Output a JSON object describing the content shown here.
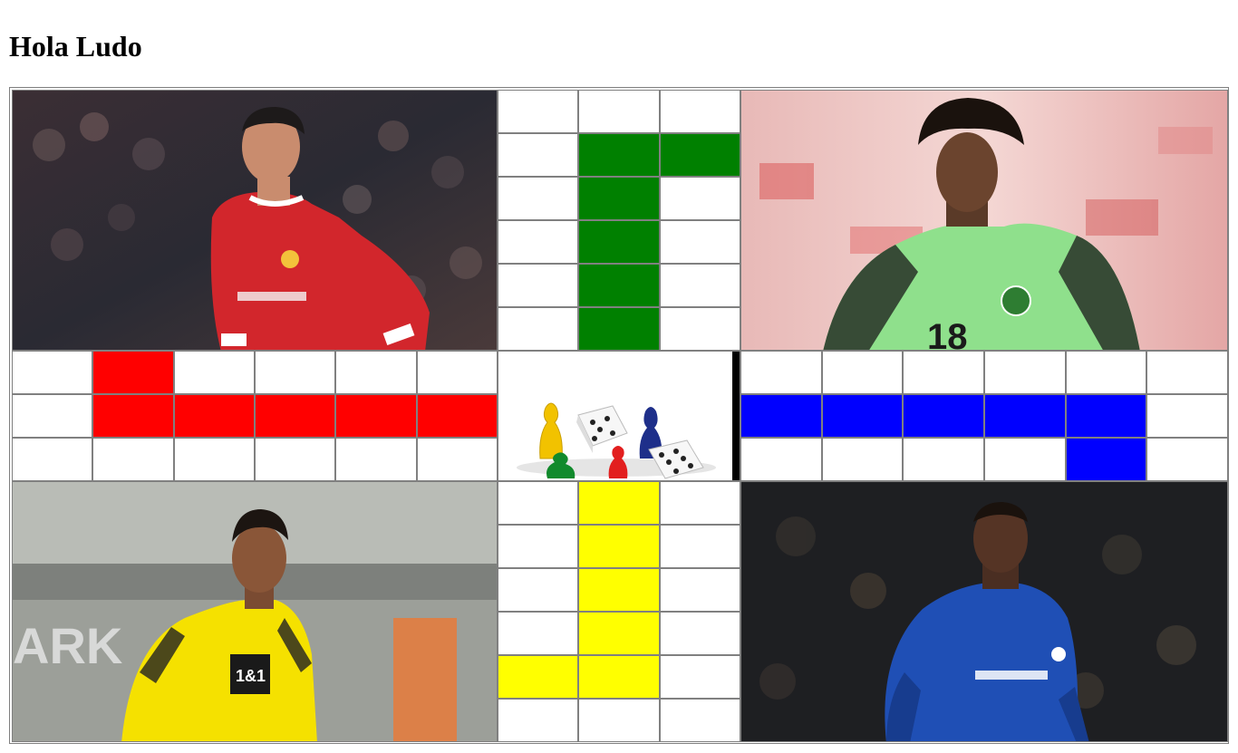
{
  "page": {
    "title": "Hola Ludo"
  },
  "colors": {
    "red": "#ff0000",
    "green": "#008000",
    "blue": "#0000ff",
    "yellow": "#ffff00",
    "empty": "#ffffff",
    "border": "#808080"
  },
  "players": [
    {
      "id": "top-left",
      "photo": "player-photo-red-jersey"
    },
    {
      "id": "top-right",
      "photo": "player-photo-green-jersey"
    },
    {
      "id": "bottom-left",
      "photo": "player-photo-yellow-jersey"
    },
    {
      "id": "bottom-right",
      "photo": "player-photo-blue-jersey"
    }
  ],
  "center": {
    "icon": "ludo-pieces-and-dice-icon"
  },
  "tracks": {
    "top": [
      [
        "empty",
        "empty",
        "empty"
      ],
      [
        "empty",
        "green",
        "green"
      ],
      [
        "empty",
        "green",
        "empty"
      ],
      [
        "empty",
        "green",
        "empty"
      ],
      [
        "empty",
        "green",
        "empty"
      ],
      [
        "empty",
        "green",
        "empty"
      ]
    ],
    "left": [
      [
        "empty",
        "red",
        "empty",
        "empty",
        "empty",
        "empty"
      ],
      [
        "empty",
        "red",
        "red",
        "red",
        "red",
        "red"
      ],
      [
        "empty",
        "empty",
        "empty",
        "empty",
        "empty",
        "empty"
      ]
    ],
    "right": [
      [
        "empty",
        "empty",
        "empty",
        "empty",
        "empty",
        "empty"
      ],
      [
        "blue",
        "blue",
        "blue",
        "blue",
        "blue",
        "empty"
      ],
      [
        "empty",
        "empty",
        "empty",
        "empty",
        "blue",
        "empty"
      ]
    ],
    "bottom": [
      [
        "empty",
        "yellow",
        "empty"
      ],
      [
        "empty",
        "yellow",
        "empty"
      ],
      [
        "empty",
        "yellow",
        "empty"
      ],
      [
        "empty",
        "yellow",
        "empty"
      ],
      [
        "yellow",
        "yellow",
        "empty"
      ],
      [
        "empty",
        "empty",
        "empty"
      ]
    ]
  }
}
